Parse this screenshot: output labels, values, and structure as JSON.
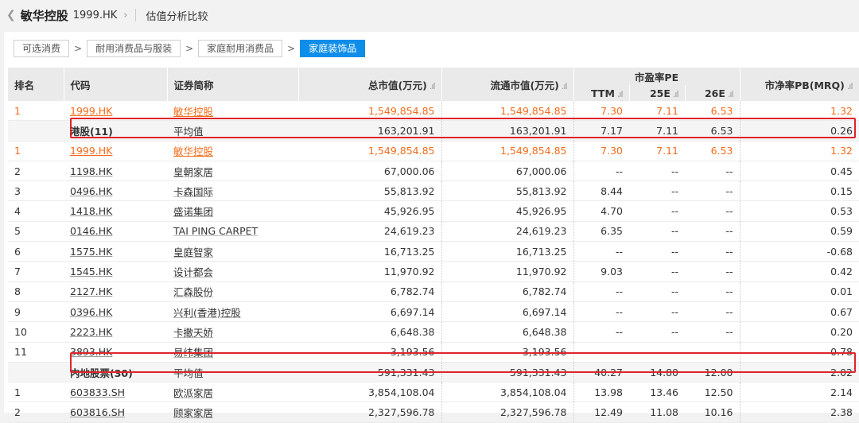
{
  "header": {
    "back_icon": "chevron-left-icon",
    "stock_name": "敏华控股",
    "stock_code": "1999.HK",
    "page_title": "估值分析比较"
  },
  "breadcrumbs": [
    "可选消费",
    "耐用消费品与服装",
    "家庭耐用消费品",
    "家庭装饰品"
  ],
  "columns": {
    "rank": "排名",
    "code": "代码",
    "name": "证券简称",
    "mktcap": "总市值(万元)",
    "float_cap": "流通市值(万元)",
    "pe_group": "市盈率PE",
    "pe_ttm": "TTM",
    "pe_25e": "25E",
    "pe_26e": "26E",
    "pb": "市净率PB(MRQ)",
    "sort_icon": "bar-chart-sort-icon"
  },
  "rows": [
    {
      "rank": "1",
      "code": "1999.HK",
      "name": "敏华控股",
      "mktcap": "1,549,854.85",
      "float": "1,549,854.85",
      "ttm": "7.30",
      "e25": "7.11",
      "e26": "6.53",
      "pb": "1.32",
      "type": "hl"
    },
    {
      "rank": "",
      "code": "港股(11)",
      "name": "平均值",
      "mktcap": "163,201.91",
      "float": "163,201.91",
      "ttm": "7.17",
      "e25": "7.11",
      "e26": "6.53",
      "pb": "0.26",
      "type": "avg"
    },
    {
      "rank": "1",
      "code": "1999.HK",
      "name": "敏华控股",
      "mktcap": "1,549,854.85",
      "float": "1,549,854.85",
      "ttm": "7.30",
      "e25": "7.11",
      "e26": "6.53",
      "pb": "1.32",
      "type": "hl"
    },
    {
      "rank": "2",
      "code": "1198.HK",
      "name": "皇朝家居",
      "mktcap": "67,000.06",
      "float": "67,000.06",
      "ttm": "--",
      "e25": "--",
      "e26": "--",
      "pb": "0.45",
      "type": ""
    },
    {
      "rank": "3",
      "code": "0496.HK",
      "name": "卡森国际",
      "mktcap": "55,813.92",
      "float": "55,813.92",
      "ttm": "8.44",
      "e25": "--",
      "e26": "--",
      "pb": "0.15",
      "type": ""
    },
    {
      "rank": "4",
      "code": "1418.HK",
      "name": "盛诺集团",
      "mktcap": "45,926.95",
      "float": "45,926.95",
      "ttm": "4.70",
      "e25": "--",
      "e26": "--",
      "pb": "0.53",
      "type": ""
    },
    {
      "rank": "5",
      "code": "0146.HK",
      "name": "TAI PING CARPET",
      "mktcap": "24,619.23",
      "float": "24,619.23",
      "ttm": "6.35",
      "e25": "--",
      "e26": "--",
      "pb": "0.59",
      "type": ""
    },
    {
      "rank": "6",
      "code": "1575.HK",
      "name": "皇庭智家",
      "mktcap": "16,713.25",
      "float": "16,713.25",
      "ttm": "--",
      "e25": "--",
      "e26": "--",
      "pb": "-0.68",
      "type": ""
    },
    {
      "rank": "7",
      "code": "1545.HK",
      "name": "设计都会",
      "mktcap": "11,970.92",
      "float": "11,970.92",
      "ttm": "9.03",
      "e25": "--",
      "e26": "--",
      "pb": "0.42",
      "type": ""
    },
    {
      "rank": "8",
      "code": "2127.HK",
      "name": "汇森股份",
      "mktcap": "6,782.74",
      "float": "6,782.74",
      "ttm": "--",
      "e25": "--",
      "e26": "--",
      "pb": "0.01",
      "type": ""
    },
    {
      "rank": "9",
      "code": "0396.HK",
      "name": "兴利(香港)控股",
      "mktcap": "6,697.14",
      "float": "6,697.14",
      "ttm": "--",
      "e25": "--",
      "e26": "--",
      "pb": "0.67",
      "type": ""
    },
    {
      "rank": "10",
      "code": "2223.HK",
      "name": "卡撒天娇",
      "mktcap": "6,648.38",
      "float": "6,648.38",
      "ttm": "--",
      "e25": "--",
      "e26": "--",
      "pb": "0.20",
      "type": ""
    },
    {
      "rank": "11",
      "code": "3893.HK",
      "name": "易纬集团",
      "mktcap": "3,193.56",
      "float": "3,193.56",
      "ttm": "--",
      "e25": "--",
      "e26": "--",
      "pb": "-0.78",
      "type": ""
    },
    {
      "rank": "",
      "code": "内地股票(30)",
      "name": "平均值",
      "mktcap": "591,331.43",
      "float": "591,331.43",
      "ttm": "40.27",
      "e25": "14.80",
      "e26": "12.00",
      "pb": "2.02",
      "type": "avg"
    },
    {
      "rank": "1",
      "code": "603833.SH",
      "name": "欧派家居",
      "mktcap": "3,854,108.04",
      "float": "3,854,108.04",
      "ttm": "13.98",
      "e25": "13.46",
      "e26": "12.50",
      "pb": "2.14",
      "type": ""
    },
    {
      "rank": "2",
      "code": "603816.SH",
      "name": "顾家家居",
      "mktcap": "2,327,596.78",
      "float": "2,327,596.78",
      "ttm": "12.49",
      "e25": "11.08",
      "e26": "10.16",
      "pb": "2.38",
      "type": ""
    }
  ],
  "colors": {
    "accent": "#0f8ee9",
    "highlight": "#f26c1b",
    "box": "#e0242a"
  }
}
